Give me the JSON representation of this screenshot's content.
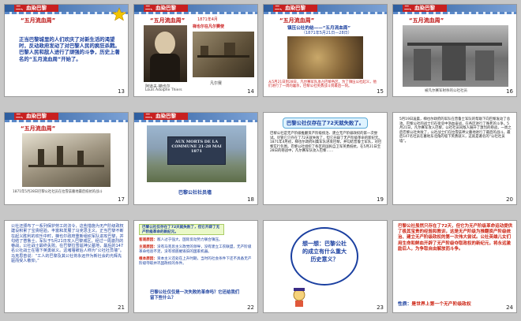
{
  "header_label": "二、血染巴黎",
  "slides": [
    {
      "num": "13",
      "subtitle": "“五月流血周”",
      "body": "正当巴黎城里的人们欢庆了对新生活的渴望时，反动政府发动了对巴黎人民的疯狂杀戮。巴黎人民和敌人进行了顽强的斗争，历史上著名的“五月流血周”开始了。"
    },
    {
      "num": "14",
      "subtitle": "“五月流血周”",
      "caption_top": "1871年4月",
      "caption_red": "梯也尔在凡尔赛使",
      "caption_red2": "凡尔赛军队向巴黎进攻",
      "caption_under": "凡尔赛",
      "caption_name": "阿道夫·梯也尔",
      "caption_name2": "Louis Adolphe Thiers"
    },
    {
      "num": "15",
      "subtitle": "“五月流血周”",
      "title_mid": "镇压公社的结——“五月流血周”",
      "title_dates": "（1871年5月21日—28日）",
      "caption_red": "从5月21日到28日，凡尔赛军队攻占巴黎各区，为了镇压公社起义，他们进行了一周的屠杀，巴黎公社英勇战斗到最后一刻。"
    },
    {
      "num": "16",
      "subtitle": "“五月流血周”",
      "caption": "被凡尔赛军射杀的公社社员"
    },
    {
      "num": "17",
      "subtitle": "“五月流血周”",
      "caption": "1871年5月28日巴黎公社社员在拉雪兹墓地最后抵抗的战斗"
    },
    {
      "num": "18",
      "wall_text": "AUX MORTS DE LA COMMUNE 21-28 MAI 1871",
      "caption": "巴黎公社社员墙"
    },
    {
      "num": "19",
      "box": "巴黎公社仅存在了72天就失败了。",
      "body": "巴黎公社是无产阶级推翻资产阶级统治、建立无产阶级政权的第一次尝试。尽管它只存在了72天就失败了，但它开辟了无产阶级革命的新纪元。1871年4月初，梯也尔政府纠集军队进攻巴黎，并勾结普鲁士军队，对巴黎实行包围。巴黎公社组织了各区的国民自卫军英勇抵抗，在5月21日至28日的巷战中，凡尔赛军队攻入巴黎……"
    },
    {
      "num": "20",
      "body": "5月19日凌晨，梯也尔政府的军队在普鲁士军队的帮助下向巴黎发动了总攻。巴黎公社的战士们在街垒中浴血奋战，在各区进行了殊死的斗争。5月21日，凡尔赛军攻入巴黎，公社社员同敌人展开了激烈的巷战，一周之后巴黎公社失败了，公社战士们在拉雪兹神父墓地进行了最后的战斗，最后147名社员在墓地东北角的墙下英勇就义，这就是著名的“公社社员墙”。"
    },
    {
      "num": "21",
      "body": "公社还颁布了一系列保护劳工的法令，这些措施为无产阶级政权建设积累了宝贵经验。丰富和发展了马克思主义。正当巴黎不断在起义胜利的欢乐中时，梯也尔政府重新组织军队进攻巴黎，并勾结了普鲁士。军队于5月21日攻入巴黎城区，经过一周激烈的巷战，公社战士最终失败。在巴黎拉雪兹神父墓地，最后的147名公社战士在墙下英勇就义。这堵墙被后人称为“公社社员墙”。马克思曾说：“工人的巴黎及其公社将永远作为新社会的光辉先驱而受人敬仰。”"
    },
    {
      "num": "22",
      "box1": "巴黎公社仅存在了72天就失败了，但它开辟了无产阶级革命的新纪元。",
      "l1": "客观原因：",
      "t1": "敌人过于强大，国际反动势力联合镇压。",
      "l2": "主观原因：",
      "t2": "没有马克思主义政党的领导，没有建立工农联盟，无产阶级革命经验不足，没有彻底摧毁旧的国家机器。",
      "l3": "根本原因：",
      "t3": "资本主义还处在上升时期，当时的社会条件下还不具备无产阶级夺取并巩固政权的条件。",
      "q": "巴黎公社仅仅是一次失败的革命吗？它还给我们留下些什么？"
    },
    {
      "num": "23",
      "cloud": "想一想：巴黎公社的成立有什么重大历史意义？"
    },
    {
      "num": "24",
      "body": "巴黎公社虽然只存在了72天，但它为无产阶级革命运动提供了极其宝贵的经验和教训，这是无产阶级为推翻资产阶级统治、建立无产阶级政权的第一次伟大尝试。公社英雄儿女们用生命和鲜血开辟了无产阶级夺取政权的新纪元，将永远激励后人，为争取自由解放而斗争。",
      "label": "性质：",
      "value": "是世界上第一个无产阶级政权"
    }
  ]
}
